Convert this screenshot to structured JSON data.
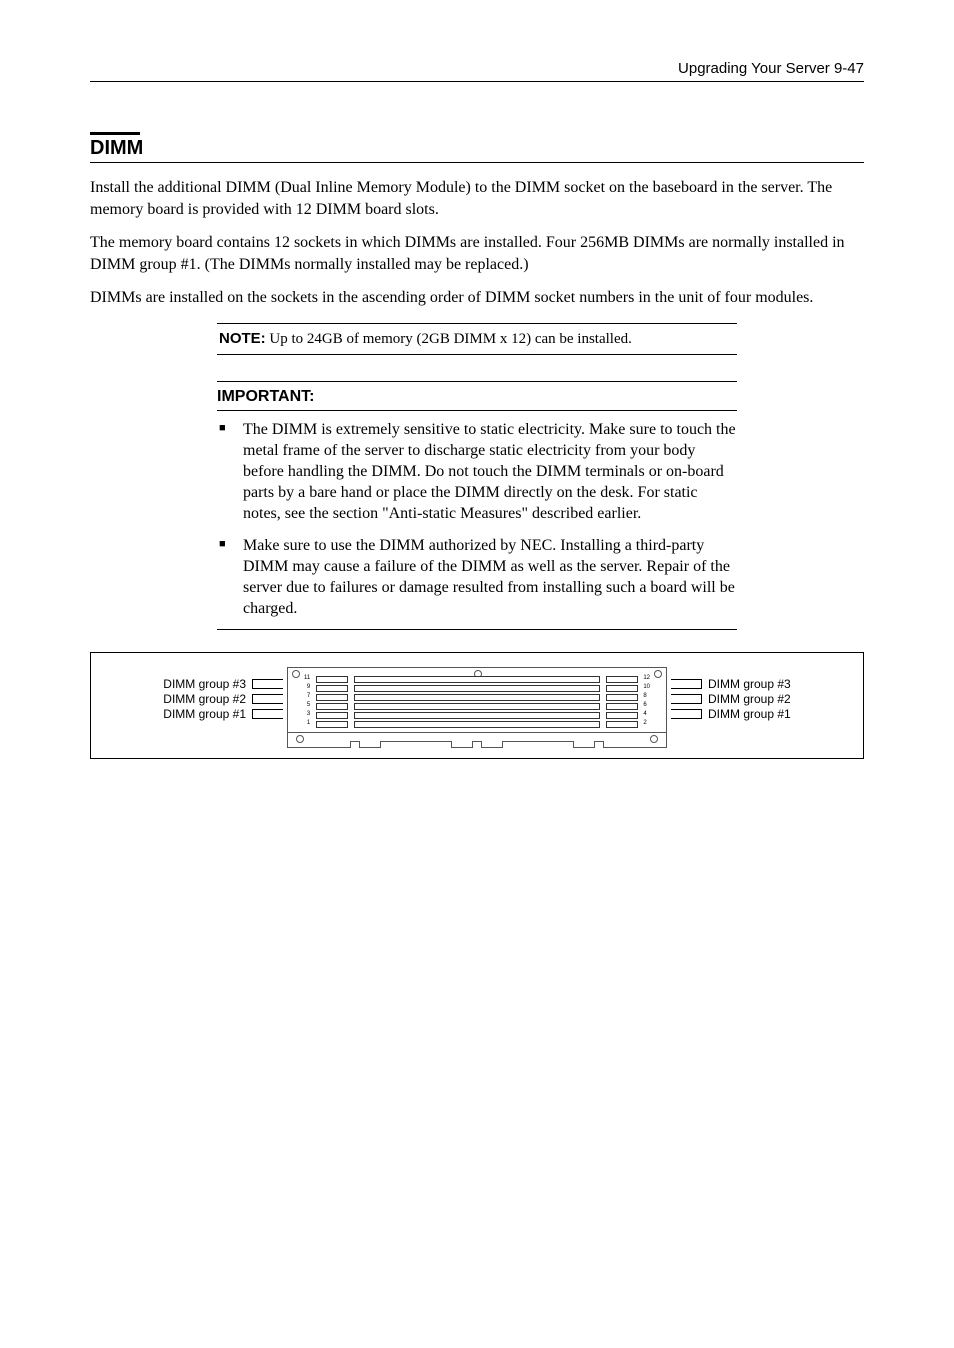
{
  "header": {
    "text": "Upgrading Your Server   9-47"
  },
  "section": {
    "title": "DIMM"
  },
  "paragraphs": {
    "p1": "Install the additional DIMM (Dual Inline Memory Module) to the DIMM socket on the baseboard in the server. The memory board is provided with 12 DIMM board slots.",
    "p2": "The memory board contains 12 sockets in which DIMMs are installed.    Four 256MB DIMMs are normally installed in DIMM group #1.    (The DIMMs normally installed may be replaced.)",
    "p3": "DIMMs are installed on the sockets in the ascending order of DIMM socket numbers in the unit of four modules."
  },
  "note": {
    "label": "NOTE:",
    "text": " Up to 24GB of memory (2GB DIMM x 12) can be installed."
  },
  "important": {
    "title": "IMPORTANT:",
    "items": [
      "The DIMM is extremely sensitive to static electricity. Make sure to touch the metal frame of the server to discharge static electricity from your body before handling the DIMM. Do not touch the DIMM terminals or on-board parts by a bare hand or place the DIMM directly on the desk. For static notes, see the section \"Anti-static Measures\" described earlier.",
      "Make sure to use the DIMM authorized by NEC. Installing a third-party DIMM may cause a failure of the DIMM as well as the server. Repair of the server due to failures or damage resulted from installing such a board will be charged."
    ]
  },
  "diagram": {
    "left_labels": [
      "DIMM group #3",
      "DIMM group #2",
      "DIMM group #1"
    ],
    "right_labels": [
      "DIMM group #3",
      "DIMM group #2",
      "DIMM group #1"
    ],
    "left_nums": [
      "11",
      "9",
      "7",
      "5",
      "3",
      "1"
    ],
    "right_nums": [
      "12",
      "10",
      "8",
      "6",
      "4",
      "2"
    ]
  }
}
